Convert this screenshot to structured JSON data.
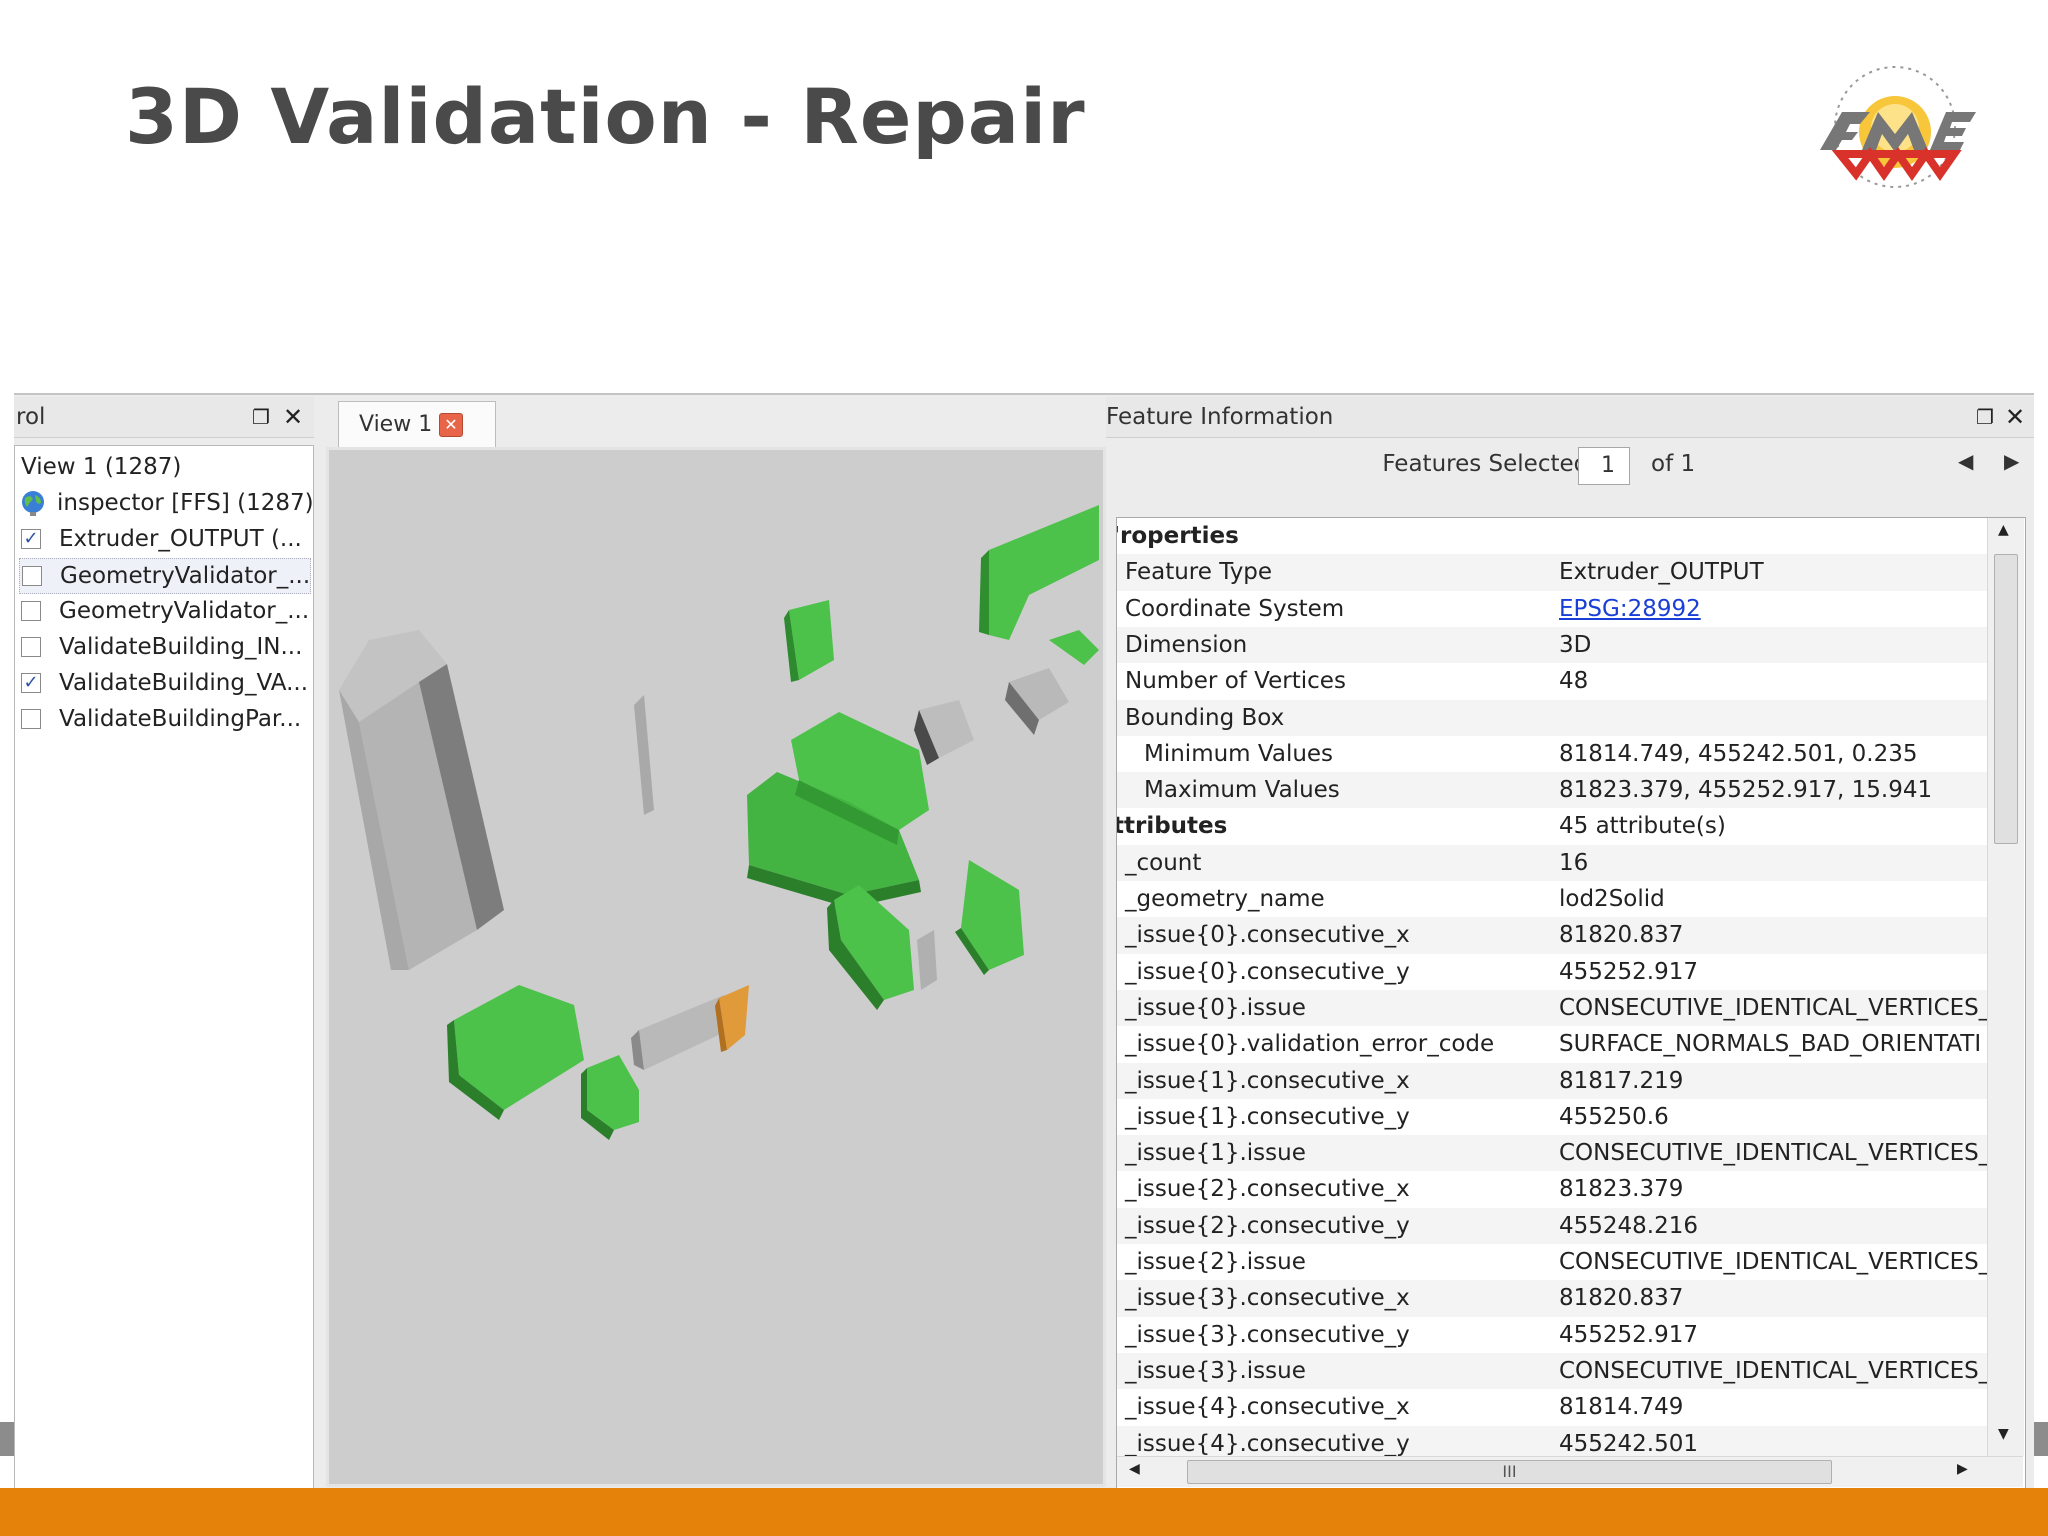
{
  "slide": {
    "title": "3D Validation - Repair"
  },
  "colors": {
    "accent_bar": "#e5820a",
    "building_green": "#4cc24a",
    "building_gray": "#a9a9a9",
    "building_orange": "#e09a3a",
    "link": "#1a3fd6"
  },
  "left_panel": {
    "header_title": "rol",
    "float_icon": "float-window-icon",
    "close_icon": "close-icon",
    "view_label": "View 1 (1287)",
    "source_label": "inspector [FFS] (1287)",
    "layers": [
      {
        "label": "Extruder_OUTPUT (...",
        "checked": true
      },
      {
        "label": "GeometryValidator_...",
        "checked": false
      },
      {
        "label": "GeometryValidator_...",
        "checked": false
      },
      {
        "label": "ValidateBuilding_IN...",
        "checked": false
      },
      {
        "label": "ValidateBuilding_VA...",
        "checked": true
      },
      {
        "label": "ValidateBuildingPar...",
        "checked": false
      }
    ]
  },
  "view": {
    "tab_label": "View 1"
  },
  "feature_info": {
    "header_title": "Feature Information",
    "features_selected_label": "Features Selected:",
    "current_index": "1",
    "of_label": "of 1",
    "rows": [
      {
        "key": "'roperties",
        "value": "",
        "kind": "group"
      },
      {
        "key": "Feature Type",
        "value": "Extruder_OUTPUT",
        "kind": "normal"
      },
      {
        "key": "Coordinate System",
        "value": "EPSG:28992",
        "kind": "link"
      },
      {
        "key": "Dimension",
        "value": "3D",
        "kind": "normal"
      },
      {
        "key": "Number of Vertices",
        "value": "48",
        "kind": "normal"
      },
      {
        "key": "Bounding Box",
        "value": "",
        "kind": "normal"
      },
      {
        "key": "Minimum Values",
        "value": "81814.749, 455242.501, 0.235",
        "kind": "indent"
      },
      {
        "key": "Maximum Values",
        "value": "81823.379, 455252.917, 15.941",
        "kind": "indent"
      },
      {
        "key": "ttributes",
        "value": "45 attribute(s)",
        "kind": "group"
      },
      {
        "key": "_count",
        "value": "16",
        "kind": "normal"
      },
      {
        "key": "_geometry_name",
        "value": "lod2Solid",
        "kind": "normal"
      },
      {
        "key": "_issue{0}.consecutive_x",
        "value": "81820.837",
        "kind": "normal"
      },
      {
        "key": "_issue{0}.consecutive_y",
        "value": "455252.917",
        "kind": "normal"
      },
      {
        "key": "_issue{0}.issue",
        "value": "CONSECUTIVE_IDENTICAL_VERTICES_",
        "kind": "normal"
      },
      {
        "key": "_issue{0}.validation_error_code",
        "value": "SURFACE_NORMALS_BAD_ORIENTATI",
        "kind": "normal"
      },
      {
        "key": "_issue{1}.consecutive_x",
        "value": "81817.219",
        "kind": "normal"
      },
      {
        "key": "_issue{1}.consecutive_y",
        "value": "455250.6",
        "kind": "normal"
      },
      {
        "key": "_issue{1}.issue",
        "value": "CONSECUTIVE_IDENTICAL_VERTICES_",
        "kind": "normal"
      },
      {
        "key": "_issue{2}.consecutive_x",
        "value": "81823.379",
        "kind": "normal"
      },
      {
        "key": "_issue{2}.consecutive_y",
        "value": "455248.216",
        "kind": "normal"
      },
      {
        "key": "_issue{2}.issue",
        "value": "CONSECUTIVE_IDENTICAL_VERTICES_",
        "kind": "normal"
      },
      {
        "key": "_issue{3}.consecutive_x",
        "value": "81820.837",
        "kind": "normal"
      },
      {
        "key": "_issue{3}.consecutive_y",
        "value": "455252.917",
        "kind": "normal"
      },
      {
        "key": "_issue{3}.issue",
        "value": "CONSECUTIVE_IDENTICAL_VERTICES_",
        "kind": "normal"
      },
      {
        "key": "_issue{4}.consecutive_x",
        "value": "81814.749",
        "kind": "normal"
      },
      {
        "key": "_issue{4}.consecutive_y",
        "value": "455242.501",
        "kind": "normal"
      }
    ],
    "scroll_thumb_grip": "III"
  }
}
